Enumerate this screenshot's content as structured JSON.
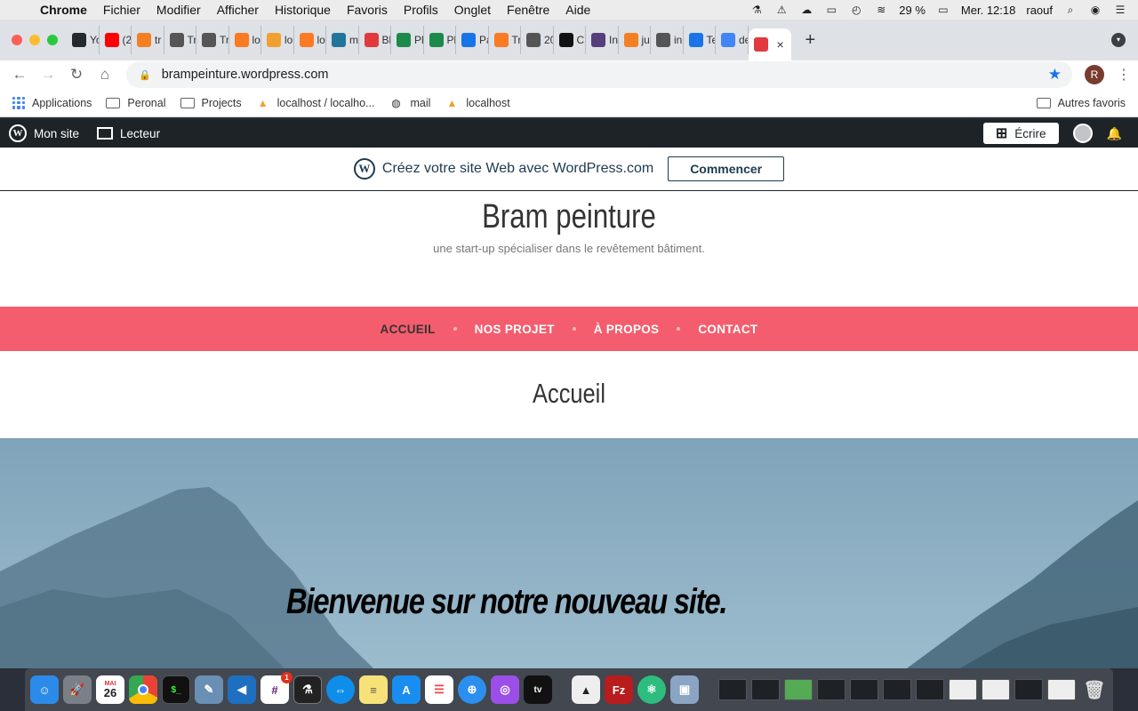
{
  "menubar": {
    "app": "Chrome",
    "items": [
      "Fichier",
      "Modifier",
      "Afficher",
      "Historique",
      "Favoris",
      "Profils",
      "Onglet",
      "Fenêtre",
      "Aide"
    ],
    "battery": "29 %",
    "clock": "Mer. 12:18",
    "user": "raouf"
  },
  "tabs": [
    {
      "title": "Yo",
      "fav": "github-icon",
      "color": "#24292e"
    },
    {
      "title": "(2",
      "fav": "youtube-icon",
      "color": "#ff0000"
    },
    {
      "title": "tr",
      "fav": "stack-icon",
      "color": "#f48024"
    },
    {
      "title": "Tr",
      "fav": "globe-icon",
      "color": "#555"
    },
    {
      "title": "Tr",
      "fav": "globe-icon",
      "color": "#555"
    },
    {
      "title": "lo",
      "fav": "xampp-icon",
      "color": "#fb7a24"
    },
    {
      "title": "lo",
      "fav": "pma-icon",
      "color": "#f0a030"
    },
    {
      "title": "lo",
      "fav": "xampp-icon",
      "color": "#fb7a24"
    },
    {
      "title": "m",
      "fav": "wordpress-icon",
      "color": "#21759b"
    },
    {
      "title": "Bl",
      "fav": "block-icon",
      "color": "#e03a3e"
    },
    {
      "title": "Pl",
      "fav": "w-icon",
      "color": "#1b8a4b"
    },
    {
      "title": "Pl",
      "fav": "w-icon",
      "color": "#1b8a4b"
    },
    {
      "title": "Pa",
      "fav": "gear-icon",
      "color": "#1a73e8"
    },
    {
      "title": "Tr",
      "fav": "xampp-icon",
      "color": "#fb7a24"
    },
    {
      "title": "20",
      "fav": "globe-icon",
      "color": "#555"
    },
    {
      "title": "C",
      "fav": "c-icon",
      "color": "#111"
    },
    {
      "title": "In",
      "fav": "bootstrap-icon",
      "color": "#563d7c"
    },
    {
      "title": "ju",
      "fav": "stack-icon",
      "color": "#f48024"
    },
    {
      "title": "in",
      "fav": "globe-icon",
      "color": "#555"
    },
    {
      "title": "Te",
      "fav": "download-icon",
      "color": "#1a73e8"
    },
    {
      "title": "de",
      "fav": "google-icon",
      "color": "#4285f4"
    },
    {
      "title": "",
      "fav": "block-icon",
      "color": "#e03a3e",
      "active": true
    }
  ],
  "toolbar": {
    "url": "brampeinture.wordpress.com",
    "profile_initial": "R"
  },
  "bookmarks": {
    "items": [
      "Applications",
      "Peronal",
      "Projects",
      "localhost / localho...",
      "mail",
      "localhost"
    ],
    "other": "Autres favoris"
  },
  "wpbar": {
    "my_site": "Mon site",
    "reader": "Lecteur",
    "write": "Écrire"
  },
  "banner": {
    "message": "Créez votre site Web avec WordPress.com",
    "button": "Commencer"
  },
  "site": {
    "title": "Bram peinture",
    "tagline": "une start-up spécialiser dans le revêtement bâtiment.",
    "nav": [
      "ACCUEIL",
      "NOS PROJET",
      "À PROPOS",
      "CONTACT"
    ],
    "heading": "Accueil",
    "hero_text": "Bienvenue sur notre nouveau site.",
    "nav_color": "#f45d6d"
  },
  "dock": {
    "calendar_day": "26",
    "calendar_month": "MAI",
    "slack_badge": "1",
    "tv_label": "tv"
  }
}
